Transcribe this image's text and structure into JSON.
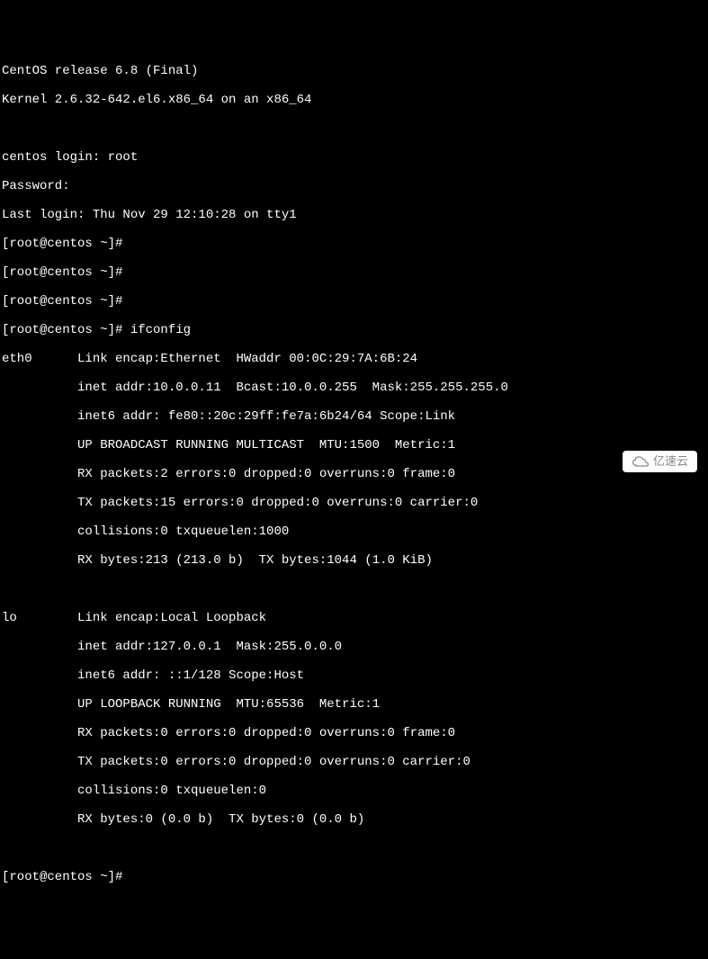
{
  "lines": [
    "CentOS release 6.8 (Final)",
    "Kernel 2.6.32-642.el6.x86_64 on an x86_64",
    "",
    "centos login: root",
    "Password:",
    "Last login: Thu Nov 29 12:10:28 on tty1",
    "[root@centos ~]#",
    "[root@centos ~]#",
    "[root@centos ~]#",
    "[root@centos ~]# ifconfig",
    "eth0      Link encap:Ethernet  HWaddr 00:0C:29:7A:6B:24",
    "          inet addr:10.0.0.11  Bcast:10.0.0.255  Mask:255.255.255.0",
    "          inet6 addr: fe80::20c:29ff:fe7a:6b24/64 Scope:Link",
    "          UP BROADCAST RUNNING MULTICAST  MTU:1500  Metric:1",
    "          RX packets:2 errors:0 dropped:0 overruns:0 frame:0",
    "          TX packets:15 errors:0 dropped:0 overruns:0 carrier:0",
    "          collisions:0 txqueuelen:1000",
    "          RX bytes:213 (213.0 b)  TX bytes:1044 (1.0 KiB)",
    "",
    "lo        Link encap:Local Loopback",
    "          inet addr:127.0.0.1  Mask:255.0.0.0",
    "          inet6 addr: ::1/128 Scope:Host",
    "          UP LOOPBACK RUNNING  MTU:65536  Metric:1",
    "          RX packets:0 errors:0 dropped:0 overruns:0 frame:0",
    "          TX packets:0 errors:0 dropped:0 overruns:0 carrier:0",
    "          collisions:0 txqueuelen:0",
    "          RX bytes:0 (0.0 b)  TX bytes:0 (0.0 b)",
    "",
    "[root@centos ~]#"
  ],
  "watermark": "亿速云"
}
